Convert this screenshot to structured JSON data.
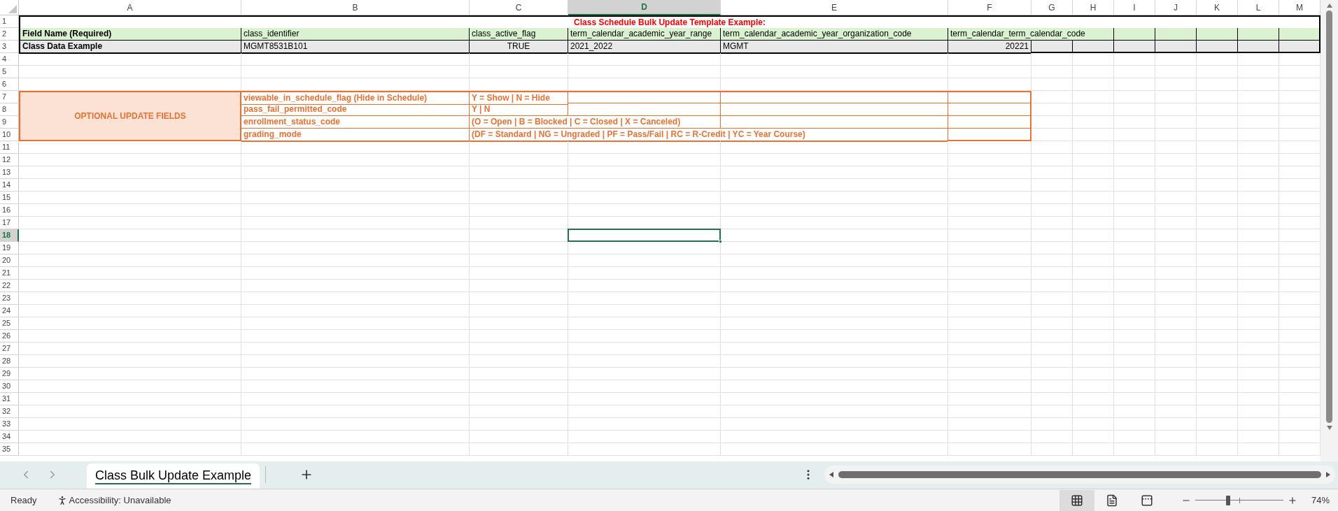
{
  "columns": [
    {
      "label": "A",
      "selected": false
    },
    {
      "label": "B",
      "selected": false
    },
    {
      "label": "C",
      "selected": false
    },
    {
      "label": "D",
      "selected": true
    },
    {
      "label": "E",
      "selected": false
    },
    {
      "label": "F",
      "selected": false
    },
    {
      "label": "G",
      "selected": false
    },
    {
      "label": "H",
      "selected": false
    },
    {
      "label": "I",
      "selected": false
    },
    {
      "label": "J",
      "selected": false
    },
    {
      "label": "K",
      "selected": false
    },
    {
      "label": "L",
      "selected": false
    },
    {
      "label": "M",
      "selected": false
    }
  ],
  "title": "Class Schedule Bulk Update Template Example:",
  "required_fields": {
    "label": "Field Name (Required)",
    "fields": [
      "class_identifier",
      "class_active_flag",
      "term_calendar_academic_year_range",
      "term_calendar_academic_year_organization_code",
      "term_calendar_term_calendar_code"
    ]
  },
  "example": {
    "label": "Class Data Example",
    "values": [
      {
        "text": "MGMT8531B101",
        "kind": "text"
      },
      {
        "text": "TRUE",
        "kind": "boolean"
      },
      {
        "text": "2021_2022",
        "kind": "text"
      },
      {
        "text": "MGMT",
        "kind": "text"
      },
      {
        "text": "20221",
        "kind": "number"
      }
    ]
  },
  "optional": {
    "label": "OPTIONAL UPDATE FIELDS",
    "fields": [
      {
        "name": "viewable_in_schedule_flag (Hide in Schedule)",
        "values": "Y = Show | N = Hide"
      },
      {
        "name": "pass_fail_permitted_code",
        "values": "Y | N"
      },
      {
        "name": "enrollment_status_code",
        "values": "(O = Open | B = Blocked | C = Closed | X = Canceled)"
      },
      {
        "name": "grading_mode",
        "values": "(DF = Standard | NG = Ungraded | PF = Pass/Fail | RC = R-Credit | YC = Year Course)"
      }
    ]
  },
  "rows": [
    {
      "label": "1",
      "selected": false
    },
    {
      "label": "2",
      "selected": false
    },
    {
      "label": "3",
      "selected": false
    },
    {
      "label": "4",
      "selected": false
    },
    {
      "label": "5",
      "selected": false
    },
    {
      "label": "6",
      "selected": false
    },
    {
      "label": "7",
      "selected": false
    },
    {
      "label": "8",
      "selected": false
    },
    {
      "label": "9",
      "selected": false
    },
    {
      "label": "10",
      "selected": false
    },
    {
      "label": "11",
      "selected": false
    },
    {
      "label": "12",
      "selected": false
    },
    {
      "label": "13",
      "selected": false
    },
    {
      "label": "14",
      "selected": false
    },
    {
      "label": "15",
      "selected": false
    },
    {
      "label": "16",
      "selected": false
    },
    {
      "label": "17",
      "selected": false
    },
    {
      "label": "18",
      "selected": true
    },
    {
      "label": "19",
      "selected": false
    },
    {
      "label": "20",
      "selected": false
    },
    {
      "label": "21",
      "selected": false
    },
    {
      "label": "22",
      "selected": false
    },
    {
      "label": "23",
      "selected": false
    },
    {
      "label": "24",
      "selected": false
    },
    {
      "label": "25",
      "selected": false
    },
    {
      "label": "26",
      "selected": false
    },
    {
      "label": "27",
      "selected": false
    },
    {
      "label": "28",
      "selected": false
    },
    {
      "label": "29",
      "selected": false
    },
    {
      "label": "30",
      "selected": false
    },
    {
      "label": "31",
      "selected": false
    },
    {
      "label": "32",
      "selected": false
    },
    {
      "label": "33",
      "selected": false
    },
    {
      "label": "34",
      "selected": false
    },
    {
      "label": "35",
      "selected": false
    }
  ],
  "sheet_tabs": [
    {
      "label": "Class Bulk Update Example",
      "selected": true
    }
  ],
  "status_bar": {
    "status": "Ready",
    "accessibility": "Accessibility: Unavailable",
    "views": [
      {
        "kind": "normal",
        "selected": true
      },
      {
        "kind": "page_layout",
        "selected": false
      },
      {
        "kind": "page_break",
        "selected": false
      }
    ],
    "zoom": {
      "level": 0.37,
      "reading": "74%"
    }
  }
}
